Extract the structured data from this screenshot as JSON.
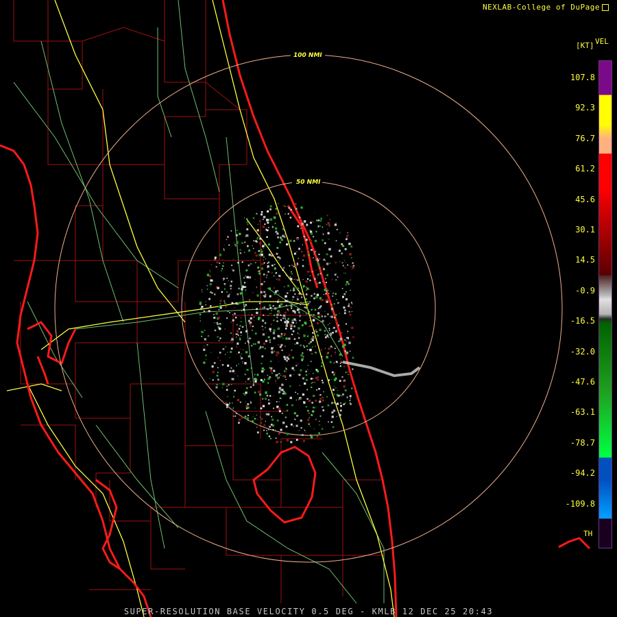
{
  "header": {
    "credit": "NEXLAB-College of DuPage"
  },
  "footer": {
    "caption": "SUPER-RESOLUTION BASE VELOCITY 0.5 DEG - KMLB 12 DEC 25 20:43"
  },
  "legend": {
    "product": "VEL",
    "units": "[KT]",
    "ticks": [
      "107.8",
      "92.3",
      "76.7",
      "61.2",
      "45.6",
      "30.1",
      "14.5",
      "-0.9",
      "-16.5",
      "-32.0",
      "-47.6",
      "-63.1",
      "-78.7",
      "-94.2",
      "-109.8"
    ],
    "range_folded": "TH",
    "colors": {
      "purple": "#7a0a8a",
      "yellow": "#ffff00",
      "orange": "#ffb080",
      "red": "#ff0000",
      "dark_red": "#5a0000",
      "gray": "#b4b4b4",
      "dark_green": "#006400",
      "green": "#00ff40",
      "blue": "#0050c0",
      "cyan": "#00a0ff"
    }
  },
  "map": {
    "range_rings": [
      "50 NMI",
      "100 NMI"
    ],
    "colors": {
      "coast": "#ff1a1a",
      "counties": "#b01010",
      "interstates": "#ffff40",
      "highways": "#70c070",
      "rings": "#f0b090"
    }
  }
}
